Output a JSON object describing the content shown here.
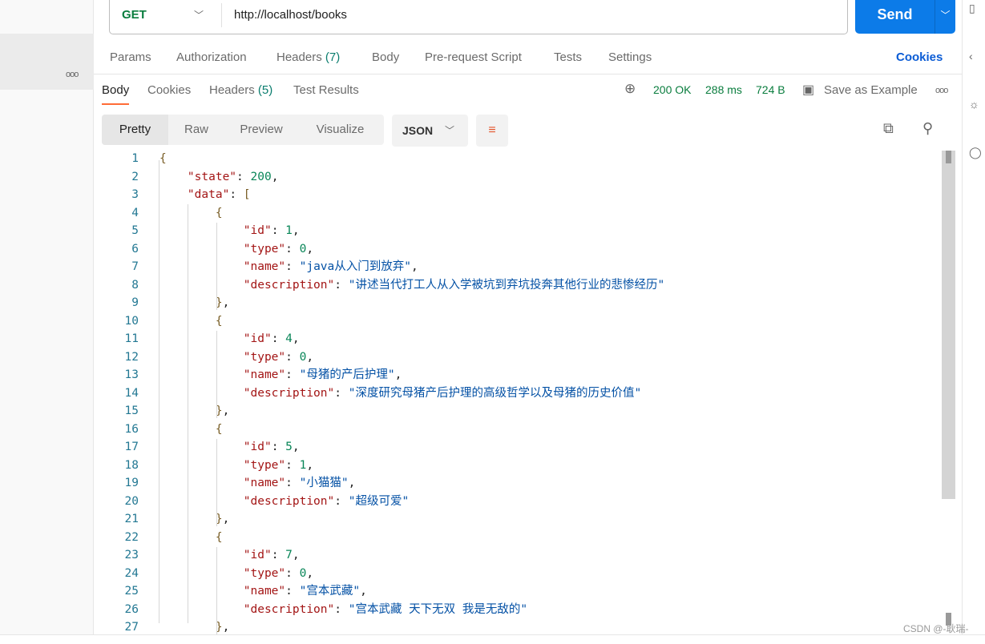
{
  "request": {
    "method": "GET",
    "url": "http://localhost/books",
    "send_label": "Send"
  },
  "request_tabs": [
    {
      "label": "Params"
    },
    {
      "label": "Authorization"
    },
    {
      "label": "Headers",
      "count": "(7)"
    },
    {
      "label": "Body"
    },
    {
      "label": "Pre-request Script"
    },
    {
      "label": "Tests"
    },
    {
      "label": "Settings"
    }
  ],
  "cookies_link": "Cookies",
  "response_tabs": [
    {
      "label": "Body",
      "active": true
    },
    {
      "label": "Cookies"
    },
    {
      "label": "Headers",
      "count": "(5)"
    },
    {
      "label": "Test Results"
    }
  ],
  "status": {
    "code": "200 OK",
    "time": "288 ms",
    "size": "724 B",
    "save_label": "Save as Example"
  },
  "view_modes": [
    "Pretty",
    "Raw",
    "Preview",
    "Visualize"
  ],
  "format": "JSON",
  "colors": {
    "accent": "#ff6c37",
    "send": "#0c7be8",
    "key": "#a31515",
    "number": "#098658",
    "string": "#0451a5"
  },
  "code_lines": [
    [
      [
        "b",
        "{"
      ]
    ],
    [
      [
        "k",
        "    \"state\""
      ],
      [
        "p",
        ": "
      ],
      [
        "n",
        "200"
      ],
      [
        "p",
        ","
      ]
    ],
    [
      [
        "k",
        "    \"data\""
      ],
      [
        "p",
        ": "
      ],
      [
        "b",
        "["
      ]
    ],
    [
      [
        "b",
        "        {"
      ]
    ],
    [
      [
        "k",
        "            \"id\""
      ],
      [
        "p",
        ": "
      ],
      [
        "n",
        "1"
      ],
      [
        "p",
        ","
      ]
    ],
    [
      [
        "k",
        "            \"type\""
      ],
      [
        "p",
        ": "
      ],
      [
        "n",
        "0"
      ],
      [
        "p",
        ","
      ]
    ],
    [
      [
        "k",
        "            \"name\""
      ],
      [
        "p",
        ": "
      ],
      [
        "s",
        "\"java从入门到放弃\""
      ],
      [
        "p",
        ","
      ]
    ],
    [
      [
        "k",
        "            \"description\""
      ],
      [
        "p",
        ": "
      ],
      [
        "s",
        "\"讲述当代打工人从入学被坑到弃坑投奔其他行业的悲惨经历\""
      ]
    ],
    [
      [
        "b",
        "        }"
      ],
      [
        "p",
        ","
      ]
    ],
    [
      [
        "b",
        "        {"
      ]
    ],
    [
      [
        "k",
        "            \"id\""
      ],
      [
        "p",
        ": "
      ],
      [
        "n",
        "4"
      ],
      [
        "p",
        ","
      ]
    ],
    [
      [
        "k",
        "            \"type\""
      ],
      [
        "p",
        ": "
      ],
      [
        "n",
        "0"
      ],
      [
        "p",
        ","
      ]
    ],
    [
      [
        "k",
        "            \"name\""
      ],
      [
        "p",
        ": "
      ],
      [
        "s",
        "\"母猪的产后护理\""
      ],
      [
        "p",
        ","
      ]
    ],
    [
      [
        "k",
        "            \"description\""
      ],
      [
        "p",
        ": "
      ],
      [
        "s",
        "\"深度研究母猪产后护理的高级哲学以及母猪的历史价值\""
      ]
    ],
    [
      [
        "b",
        "        }"
      ],
      [
        "p",
        ","
      ]
    ],
    [
      [
        "b",
        "        {"
      ]
    ],
    [
      [
        "k",
        "            \"id\""
      ],
      [
        "p",
        ": "
      ],
      [
        "n",
        "5"
      ],
      [
        "p",
        ","
      ]
    ],
    [
      [
        "k",
        "            \"type\""
      ],
      [
        "p",
        ": "
      ],
      [
        "n",
        "1"
      ],
      [
        "p",
        ","
      ]
    ],
    [
      [
        "k",
        "            \"name\""
      ],
      [
        "p",
        ": "
      ],
      [
        "s",
        "\"小猫猫\""
      ],
      [
        "p",
        ","
      ]
    ],
    [
      [
        "k",
        "            \"description\""
      ],
      [
        "p",
        ": "
      ],
      [
        "s",
        "\"超级可爱\""
      ]
    ],
    [
      [
        "b",
        "        }"
      ],
      [
        "p",
        ","
      ]
    ],
    [
      [
        "b",
        "        {"
      ]
    ],
    [
      [
        "k",
        "            \"id\""
      ],
      [
        "p",
        ": "
      ],
      [
        "n",
        "7"
      ],
      [
        "p",
        ","
      ]
    ],
    [
      [
        "k",
        "            \"type\""
      ],
      [
        "p",
        ": "
      ],
      [
        "n",
        "0"
      ],
      [
        "p",
        ","
      ]
    ],
    [
      [
        "k",
        "            \"name\""
      ],
      [
        "p",
        ": "
      ],
      [
        "s",
        "\"宫本武藏\""
      ],
      [
        "p",
        ","
      ]
    ],
    [
      [
        "k",
        "            \"description\""
      ],
      [
        "p",
        ": "
      ],
      [
        "s",
        "\"宫本武藏 天下无双 我是无敌的\""
      ]
    ],
    [
      [
        "b",
        "        }"
      ],
      [
        "p",
        ","
      ]
    ]
  ],
  "watermark": "CSDN @-耿瑞-"
}
